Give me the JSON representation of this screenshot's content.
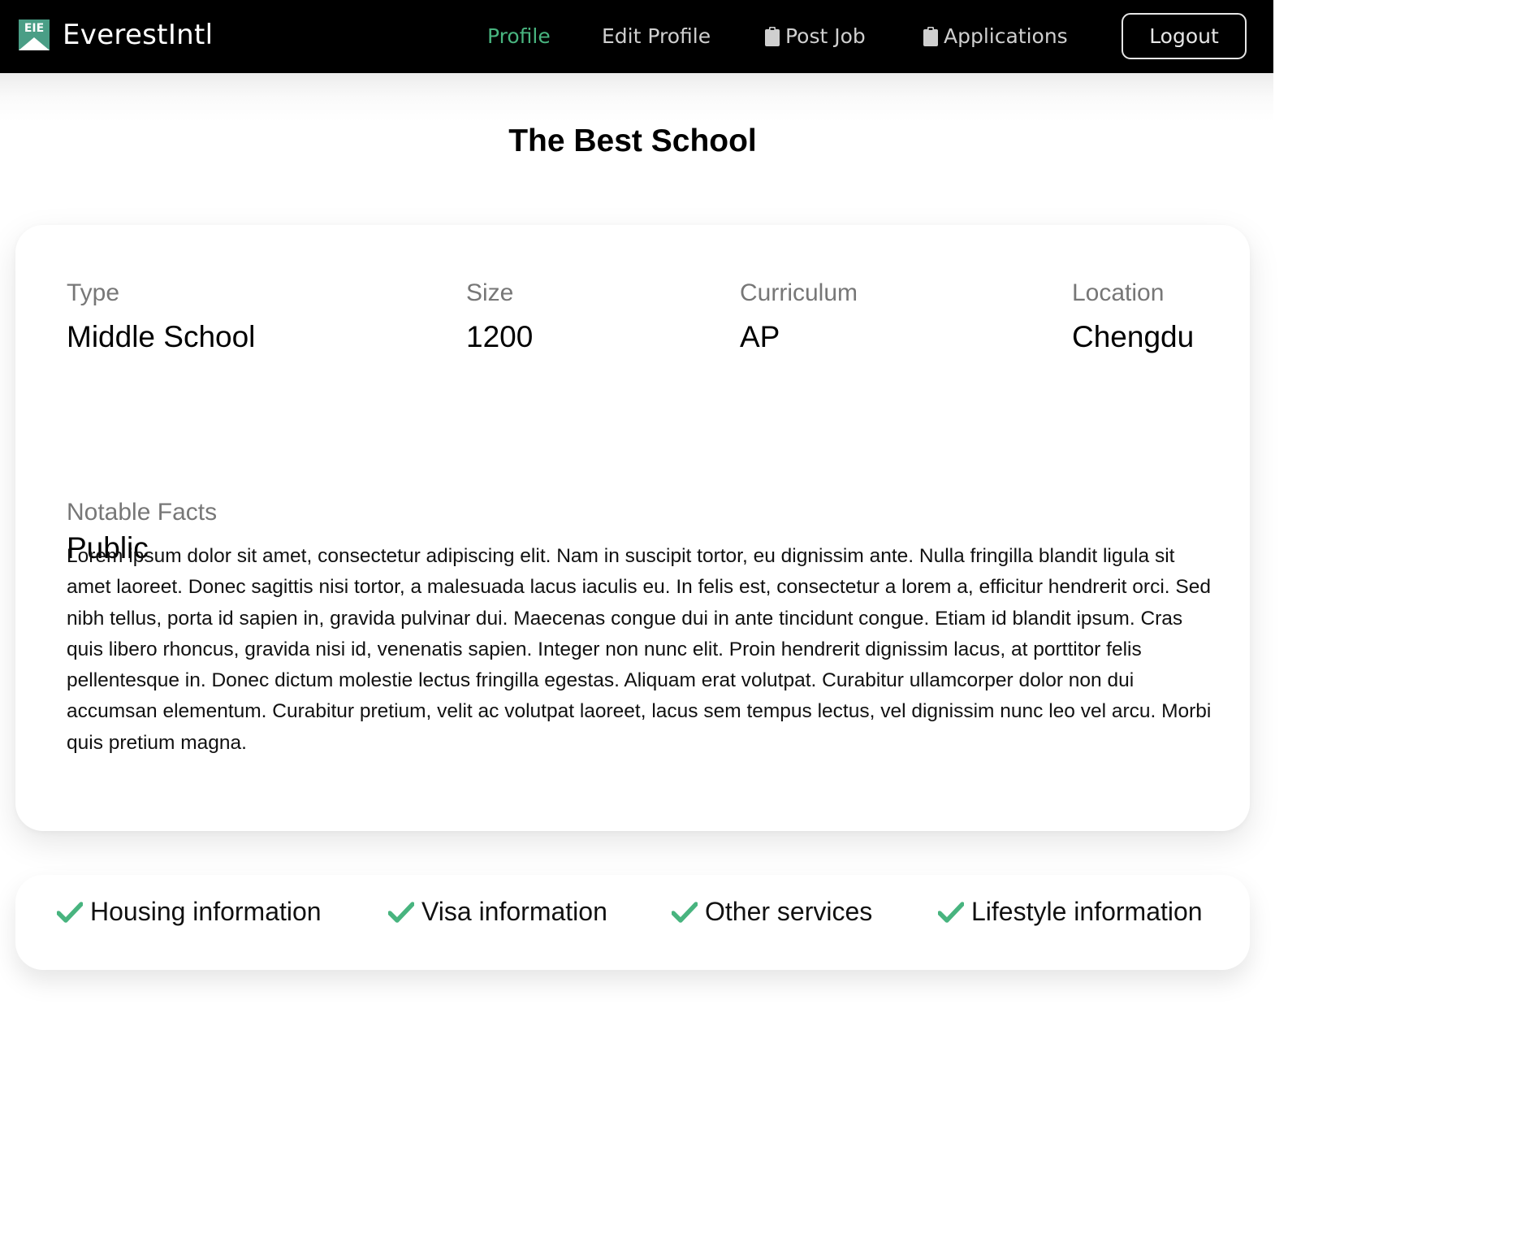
{
  "navbar": {
    "logo_text": "EIE",
    "brand": "EverestIntl",
    "links": {
      "profile": "Profile",
      "edit_profile": "Edit Profile",
      "post_job": "Post Job",
      "applications": "Applications"
    },
    "logout": "Logout",
    "active_color": "#48b47f",
    "active_link": "profile",
    "icons": {
      "post_job": "clipboard-icon",
      "applications": "clipboard-icon"
    }
  },
  "school": {
    "name": "The Best School",
    "fields": {
      "type_label": "Type",
      "type_value": "Middle School",
      "type_value_2": "Public",
      "size_label": "Size",
      "size_value": "1200",
      "curriculum_label": "Curriculum",
      "curriculum_value": "AP",
      "location_label": "Location",
      "location_value": "Chengdu"
    },
    "notable_facts_label": "Notable Facts",
    "notable_facts_text": "Lorem ipsum dolor sit amet, consectetur adipiscing elit. Nam in suscipit tortor, eu dignissim ante. Nulla fringilla blandit ligula sit amet laoreet. Donec sagittis nisi tortor, a malesuada lacus iaculis eu. In felis est, consectetur a lorem a, efficitur hendrerit orci. Sed nibh tellus, porta id sapien in, gravida pulvinar dui. Maecenas congue dui in ante tincidunt congue. Etiam id blandit ipsum. Cras quis libero rhoncus, gravida nisi id, venenatis sapien. Integer non nunc elit. Proin hendrerit dignissim lacus, at porttitor felis pellentesque in. Donec dictum molestie lectus fringilla egestas. Aliquam erat volutpat. Curabitur ullamcorper dolor non dui accumsan elementum. Curabitur pretium, velit ac volutpat laoreet, lacus sem tempus lectus, vel dignissim nunc leo vel arcu. Morbi quis pretium magna."
  },
  "services": {
    "items": [
      "Housing information",
      "Visa information",
      "Other services",
      "Lifestyle information"
    ],
    "icon": "check-icon",
    "check_color": "#48b47f"
  }
}
